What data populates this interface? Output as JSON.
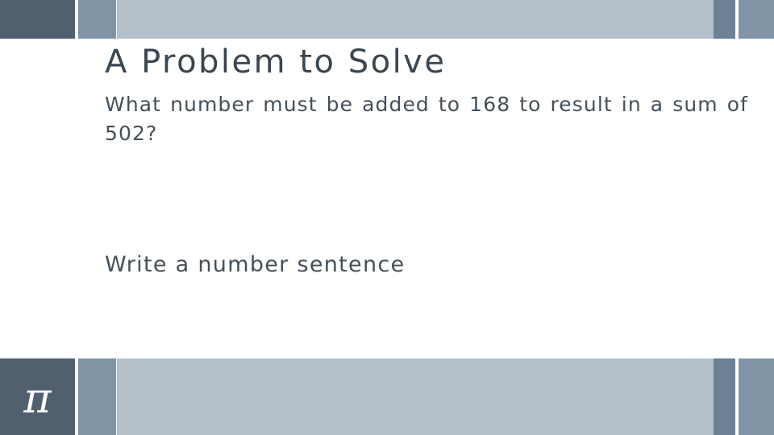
{
  "slide": {
    "title": "A Problem to Solve",
    "body_paragraph": "What number must be added to 168 to result in a sum of 502?",
    "sub_paragraph": "Write a number sentence"
  },
  "logo": {
    "glyph": "π",
    "name": "pi-symbol"
  },
  "theme": {
    "dark_slate": "#515f6e",
    "medium_blue": "#8194a5",
    "light_blue": "#b5bfc9",
    "accent_blue": "#6d8096",
    "title_text": "#3a4650",
    "body_text": "#44505a",
    "background": "#ffffff"
  }
}
